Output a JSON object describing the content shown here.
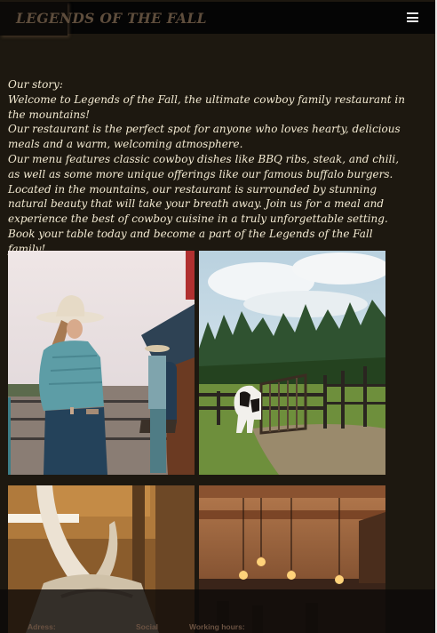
{
  "header": {
    "brand": "LEGENDS OF THE FALL",
    "menu_icon": "hamburger-menu-icon"
  },
  "story": {
    "lines": [
      "Our story:",
      "Welcome to Legends of the Fall, the ultimate cowboy family restaurant in the mountains!",
      "Our restaurant is the perfect spot for anyone who loves hearty, delicious meals and a warm, welcoming atmosphere.",
      "Our menu features classic cowboy dishes like BBQ ribs, steak, and chili, as well as some more unique offerings like our famous buffalo burgers.",
      "Located in the mountains, our restaurant is surrounded by stunning natural beauty that will take your breath away. Join us for a meal and experience the best of cowboy cuisine in a truly unforgettable setting.",
      "Book your table today and become a part of the Legends of the Fall family!"
    ]
  },
  "gallery": {
    "photos": [
      "cowgirl-photo",
      "cow-field-photo",
      "bull-horns-photo",
      "restaurant-interior-photo"
    ]
  },
  "footer": {
    "address_label": "Adress:",
    "social_label": "Social",
    "hours_label": "Working hours:"
  },
  "colors": {
    "page_background": "#1d1810",
    "header_background": "#050505",
    "brand_text": "#5e4d3c",
    "body_text": "#f3ead2",
    "footer_text": "#6a5242"
  }
}
